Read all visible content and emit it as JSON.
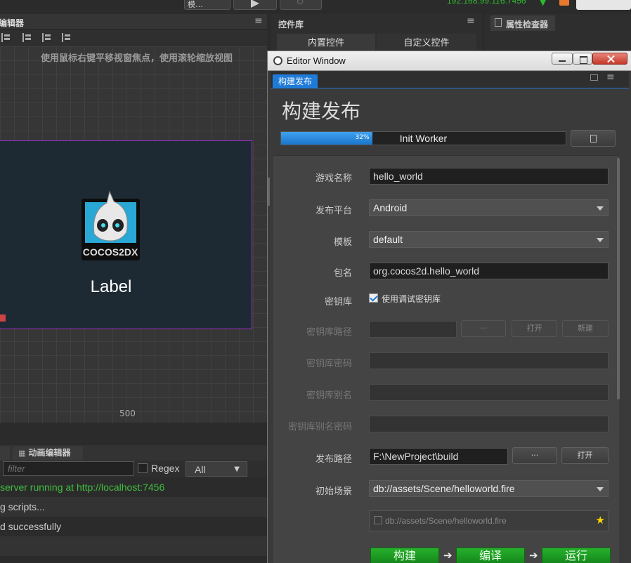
{
  "topbar": {
    "address": "192.168.99.116:7456",
    "platform_dropdown": "模…"
  },
  "scene_editor": {
    "tab": "编辑器",
    "hint": "使用鼠标右键平移视窗焦点，使用滚轮缩放视图",
    "label_node": "Label",
    "logo_text": "COCOS2DX",
    "ruler_value": "500"
  },
  "bottom": {
    "tab_animation": "动画编辑器",
    "filter_placeholder": "filter",
    "regex_label": "Regex",
    "level_select": "All",
    "console_lines": [
      "server running at http://localhost:7456",
      "g scripts...",
      "d successfully"
    ]
  },
  "control_panel": {
    "title": "控件库",
    "tab_builtin": "内置控件",
    "tab_custom": "自定义控件"
  },
  "inspector": {
    "title": "属性检查器"
  },
  "editor_window": {
    "title": "Editor Window",
    "tab": "构建发布",
    "heading": "构建发布",
    "progress_percent": 32,
    "progress_label": "32%",
    "progress_status": "Init Worker",
    "form": {
      "game_name_label": "游戏名称",
      "game_name_value": "hello_world",
      "platform_label": "发布平台",
      "platform_value": "Android",
      "template_label": "模板",
      "template_value": "default",
      "package_label": "包名",
      "package_value": "org.cocos2d.hello_world",
      "keystore_label": "密钥库",
      "keystore_checkbox_label": "使用调试密钥库",
      "keystore_path_label": "密钥库路径",
      "keystore_path_browse": "···",
      "keystore_path_open": "打开",
      "keystore_path_new": "新建",
      "keystore_password_label": "密钥库密码",
      "keystore_alias_label": "密钥库别名",
      "keystore_alias_password_label": "密钥库别名密码",
      "build_path_label": "发布路径",
      "build_path_value": "F:\\NewProject\\build",
      "build_path_browse": "···",
      "build_path_open": "打开",
      "start_scene_label": "初始场景",
      "start_scene_value": "db://assets/Scene/helloworld.fire",
      "scene_list_item": "db://assets/Scene/helloworld.fire"
    },
    "actions": {
      "build": "构建",
      "compile": "编译",
      "run": "运行"
    }
  },
  "colors": {
    "accent": "#1f7bd8",
    "green_button": "#1a9a20",
    "server_text": "#3fbf3f"
  }
}
